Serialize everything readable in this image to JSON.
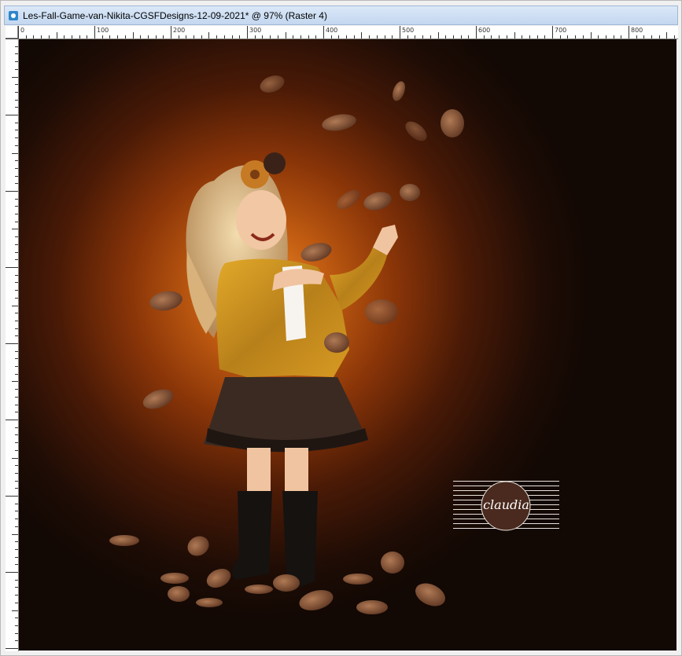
{
  "window": {
    "title": "Les-Fall-Game-van-Nikita-CGSFDesigns-12-09-2021* @  97% (Raster 4)"
  },
  "ruler": {
    "top_labels": [
      "0",
      "100",
      "200",
      "300",
      "400",
      "500",
      "600",
      "700",
      "800"
    ]
  },
  "watermark": {
    "text": "claudia"
  },
  "colors": {
    "title_bar": "#c4d7ef",
    "canvas_glow": "#e98a2a",
    "canvas_dark": "#120804",
    "leaf": "#8a5a3c"
  }
}
